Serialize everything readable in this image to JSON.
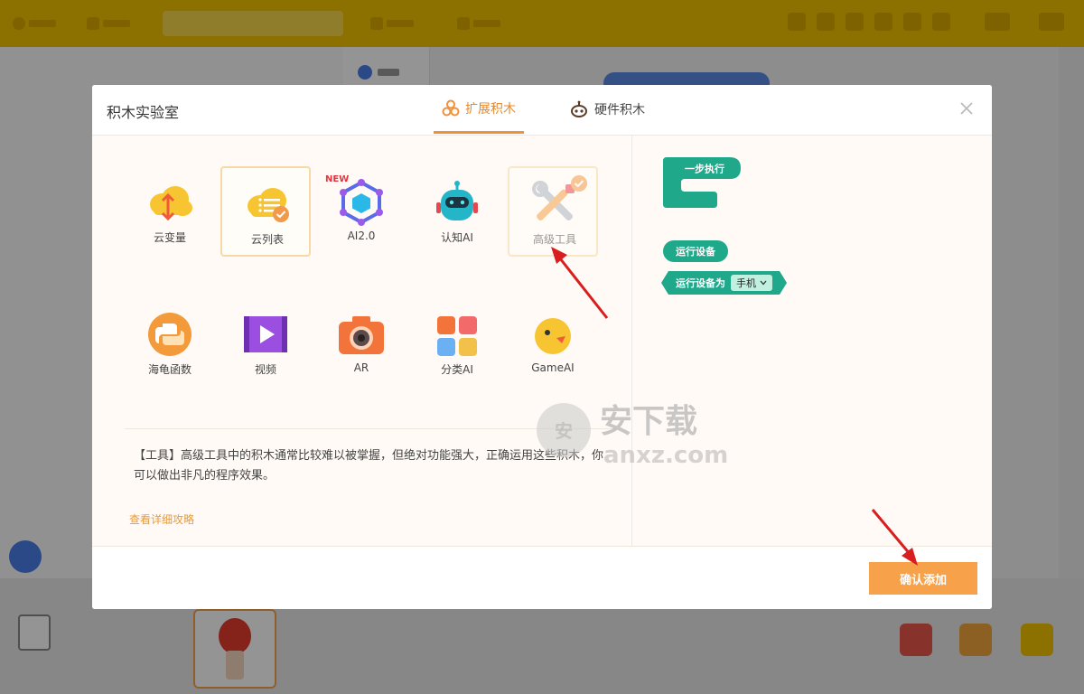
{
  "dialog": {
    "title": "积木实验室",
    "tabs": [
      {
        "label": "扩展积木",
        "active": true,
        "icon": "extension-icon"
      },
      {
        "label": "硬件积木",
        "active": false,
        "icon": "hardware-robot-icon"
      }
    ],
    "close_icon": "close-icon"
  },
  "extensions": [
    {
      "label": "云变量",
      "icon": "cloud-variable-icon",
      "selected": false
    },
    {
      "label": "云列表",
      "icon": "cloud-list-icon",
      "selected": true
    },
    {
      "label": "AI2.0",
      "icon": "ai2-hexagon-icon",
      "selected": false,
      "badge": "NEW"
    },
    {
      "label": "认知AI",
      "icon": "cognitive-ai-robot-icon",
      "selected": false
    },
    {
      "label": "高级工具",
      "icon": "advanced-tools-icon",
      "selected": true
    },
    {
      "label": "海龟函数",
      "icon": "python-turtle-icon",
      "selected": false
    },
    {
      "label": "视频",
      "icon": "video-icon",
      "selected": false
    },
    {
      "label": "AR",
      "icon": "ar-camera-icon",
      "selected": false
    },
    {
      "label": "分类AI",
      "icon": "classification-ai-icon",
      "selected": false
    },
    {
      "label": "GameAI",
      "icon": "game-ai-icon",
      "selected": false
    }
  ],
  "description": "【工具】高级工具中的积木通常比较难以被掌握，但绝对功能强大，正确运用这些积木，你可以做出非凡的程序效果。",
  "guide_link": "查看详细攻略",
  "preview_blocks": {
    "step": "一步执行",
    "run_device": "运行设备",
    "run_device_as": "运行设备为",
    "device_option": "手机"
  },
  "confirm_button": "确认添加",
  "watermark": {
    "text": "安下载",
    "domain": "anxz.com"
  },
  "colors": {
    "accent": "#f7a24a",
    "tab_active": "#e58a2c",
    "block_green": "#1fa98a",
    "topbar": "#f2c100",
    "annotation_arrow": "#d81e1e"
  }
}
